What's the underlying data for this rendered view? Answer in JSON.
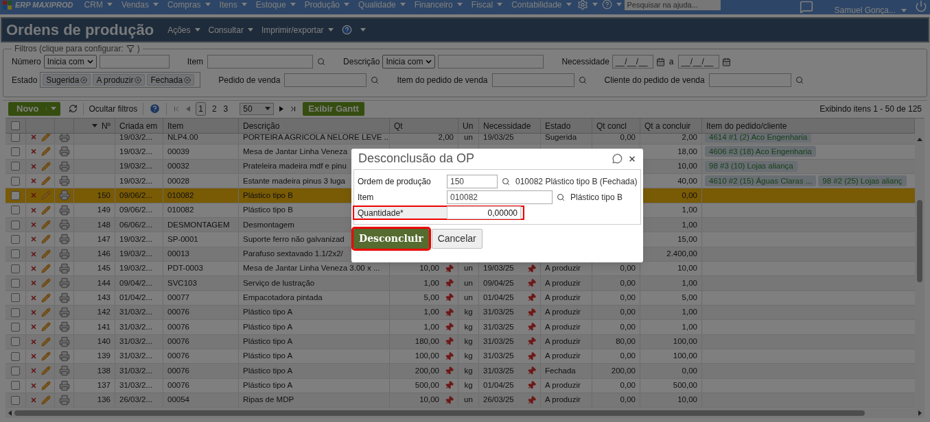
{
  "top_nav": {
    "brand": "ERP MAXIPROD",
    "menus": [
      "CRM",
      "Vendas",
      "Compras",
      "Itens",
      "Estoque",
      "Produção",
      "Qualidade",
      "Financeiro",
      "Fiscal",
      "Contabilidade"
    ],
    "search": {
      "placeholder": "Pesquisar na ajuda..."
    },
    "user": "Samuel Gonça..."
  },
  "page": {
    "title": "Ordens de produção",
    "menus": [
      "Ações",
      "Consultar",
      "Imprimir/exportar"
    ]
  },
  "filters": {
    "legend_start": "Filtros (clique para configurar:",
    "legend_end": ")",
    "rows": [
      [
        {
          "kind": "select_text",
          "label": "Número",
          "select": "Inicia com"
        },
        {
          "kind": "search",
          "label": "Item"
        },
        {
          "kind": "select_text",
          "label": "Descrição",
          "select": "Inicia com"
        },
        {
          "kind": "date_range",
          "label": "Necessidade",
          "from": "__/__/__",
          "separator": "a",
          "to": "__/__/__"
        }
      ],
      [
        {
          "kind": "tags",
          "label": "Estado",
          "tags": [
            "Sugerida",
            "A produzir",
            "Fechada"
          ]
        },
        {
          "kind": "search",
          "label": "Pedido de venda"
        },
        {
          "kind": "search",
          "label": "Item do pedido de venda"
        },
        {
          "kind": "search",
          "label": "Cliente do pedido de venda"
        }
      ]
    ]
  },
  "toolbar": {
    "new_button": "Novo",
    "hide_filters": "Ocultar filtros",
    "pages": [
      {
        "label": "1",
        "selected": true
      },
      {
        "label": "2",
        "selected": false
      },
      {
        "label": "3",
        "selected": false
      }
    ],
    "page_size": "50",
    "gantt_button": "Exibir Gantt",
    "summary": "Exibindo itens 1 - 50 de 125"
  },
  "table": {
    "all_checked": false,
    "columns": [
      "Nº",
      "Criada em",
      "Item",
      "Descrição",
      "Qt",
      "Un",
      "Necessidade",
      "Estado",
      "Qt concl",
      "Qt a concluir",
      "Item do pedido/cliente"
    ],
    "rows": [
      {
        "checked": false,
        "selected": false,
        "pinned": false,
        "no": "",
        "created": "19/03/2...",
        "item": "NLP4.00",
        "description": "PORTEIRA AGRICOLA NELORE LEVE ...",
        "qt": "2,00",
        "un": "un",
        "need": "19/03/25",
        "status": "Sugerida",
        "qt_done": "0,00",
        "qt_todo": "2,00",
        "orders": [
          "4614 #1 (2) Aco Engenharia"
        ]
      },
      {
        "checked": false,
        "selected": false,
        "pinned": false,
        "no": "",
        "created": "19/03/2...",
        "item": "00039",
        "description": "Mesa de Jantar Linha Veneza",
        "qt_todo": "18,00",
        "orders": [
          "4606 #3 (18) Aco Engenharia"
        ]
      },
      {
        "checked": false,
        "selected": false,
        "pinned": false,
        "no": "",
        "created": "19/03/2...",
        "item": "00032",
        "description": "Prateleira madeira mdf e pinu",
        "qt_todo": "10,00",
        "orders": [
          "98 #3 (10) Lojas aliança"
        ]
      },
      {
        "checked": false,
        "selected": false,
        "pinned": false,
        "no": "",
        "created": "19/03/2...",
        "item": "00028",
        "description": "Estante madeira pinus 3 luga",
        "qt_todo": "40,00",
        "orders": [
          "4610 #2 (15) Águas Claras ...",
          "98 #2 (25) Lojas alianç"
        ]
      },
      {
        "checked": false,
        "selected": true,
        "pinned": false,
        "no": "150",
        "created": "09/06/2...",
        "item": "010082",
        "description": "Plástico tipo B",
        "qt_todo": "0,00"
      },
      {
        "checked": false,
        "selected": false,
        "pinned": false,
        "no": "149",
        "created": "09/06/2...",
        "item": "010082",
        "description": "Plástico tipo B",
        "qt_todo": "1,00"
      },
      {
        "checked": false,
        "selected": false,
        "pinned": false,
        "no": "148",
        "created": "06/06/2...",
        "item": "DESMONTAGEM",
        "description": "Desmontagem",
        "qt_todo": "1,00"
      },
      {
        "checked": false,
        "selected": false,
        "pinned": false,
        "no": "147",
        "created": "19/03/2...",
        "item": "SP-0001",
        "description": "Suporte ferro não galvanizad",
        "qt_todo": "15,00"
      },
      {
        "checked": false,
        "selected": false,
        "pinned": false,
        "no": "146",
        "created": "19/03/2...",
        "item": "00013",
        "description": "Parafuso sextavado 1.1/2x2/",
        "qt_todo": "2.400,00"
      },
      {
        "checked": false,
        "selected": false,
        "pinned": true,
        "no": "145",
        "created": "19/03/2...",
        "item": "PDT-0003",
        "description": "Mesa de Jantar Linha Veneza 3.00 x ...",
        "qt": "10,00",
        "un": "un",
        "need": "19/03/25",
        "status": "A produzir",
        "qt_done": "0,00",
        "qt_todo": "10,00"
      },
      {
        "checked": false,
        "selected": false,
        "pinned": true,
        "no": "144",
        "created": "09/04/2...",
        "item": "SVC103",
        "description": "Serviço de lustração",
        "qt": "1,00",
        "un": "un",
        "need": "09/04/25",
        "status": "A produzir",
        "qt_done": "0,00",
        "qt_todo": "1,00"
      },
      {
        "checked": false,
        "selected": false,
        "pinned": true,
        "no": "143",
        "created": "01/04/2...",
        "item": "00077",
        "description": "Empacotadora pintada",
        "qt": "5,00",
        "un": "un",
        "need": "01/04/25",
        "status": "A produzir",
        "qt_done": "0,00",
        "qt_todo": "5,00"
      },
      {
        "checked": false,
        "selected": false,
        "pinned": true,
        "no": "142",
        "created": "31/03/2...",
        "item": "00076",
        "description": "Plástico tipo A",
        "qt": "1,00",
        "un": "kg",
        "need": "31/03/25",
        "status": "A produzir",
        "qt_done": "0,00",
        "qt_todo": "1,00"
      },
      {
        "checked": false,
        "selected": false,
        "pinned": true,
        "no": "141",
        "created": "31/03/2...",
        "item": "00076",
        "description": "Plástico tipo A",
        "qt": "1,00",
        "un": "kg",
        "need": "31/03/25",
        "status": "A produzir",
        "qt_done": "0,00",
        "qt_todo": "1,00"
      },
      {
        "checked": false,
        "selected": false,
        "pinned": true,
        "no": "140",
        "created": "31/03/2...",
        "item": "00076",
        "description": "Plástico tipo A",
        "qt": "180,00",
        "un": "kg",
        "need": "31/03/25",
        "status": "A produzir",
        "qt_done": "80,00",
        "qt_todo": "100,00"
      },
      {
        "checked": false,
        "selected": false,
        "pinned": true,
        "no": "139",
        "created": "31/03/2...",
        "item": "00076",
        "description": "Plástico tipo A",
        "qt": "100,00",
        "un": "kg",
        "need": "31/03/25",
        "status": "A produzir",
        "qt_done": "0,00",
        "qt_todo": "100,00"
      },
      {
        "checked": false,
        "selected": false,
        "pinned": true,
        "no": "138",
        "created": "31/03/2...",
        "item": "00076",
        "description": "Plástico tipo A",
        "qt": "200,00",
        "un": "kg",
        "need": "31/03/25",
        "status": "Fechada",
        "qt_done": "200,00",
        "qt_todo": "0,00"
      },
      {
        "checked": false,
        "selected": false,
        "pinned": true,
        "no": "137",
        "created": "31/03/2...",
        "item": "00076",
        "description": "Plástico tipo A",
        "qt": "500,00",
        "un": "kg",
        "need": "01/04/25",
        "status": "A produzir",
        "qt_done": "0,00",
        "qt_todo": "500,00"
      },
      {
        "checked": false,
        "selected": false,
        "pinned": true,
        "no": "136",
        "created": "26/03/2...",
        "item": "00054",
        "description": "Ripas de MDP",
        "qt": "10,00",
        "un": "un",
        "need": "26/03/25",
        "status": "A produzir",
        "qt_done": "0,00",
        "qt_todo": "10,00"
      }
    ]
  },
  "dialog": {
    "title": "Desconclusão da OP",
    "fields": [
      {
        "kind": "lookup",
        "label": "Ordem de produção",
        "value": "150",
        "note": "010082 Plástico tipo B (Fechada)",
        "highlighted": false
      },
      {
        "kind": "lookup",
        "label": "Item",
        "value": "010082",
        "note": "Plástico tipo B",
        "highlighted": false
      },
      {
        "kind": "number",
        "label": "Quantidade*",
        "value": "0,00000",
        "highlighted": true
      }
    ],
    "buttons": [
      {
        "kind": "primary",
        "label": "Desconcluir",
        "highlighted": true
      },
      {
        "kind": "secondary",
        "label": "Cancelar",
        "highlighted": false
      }
    ]
  }
}
